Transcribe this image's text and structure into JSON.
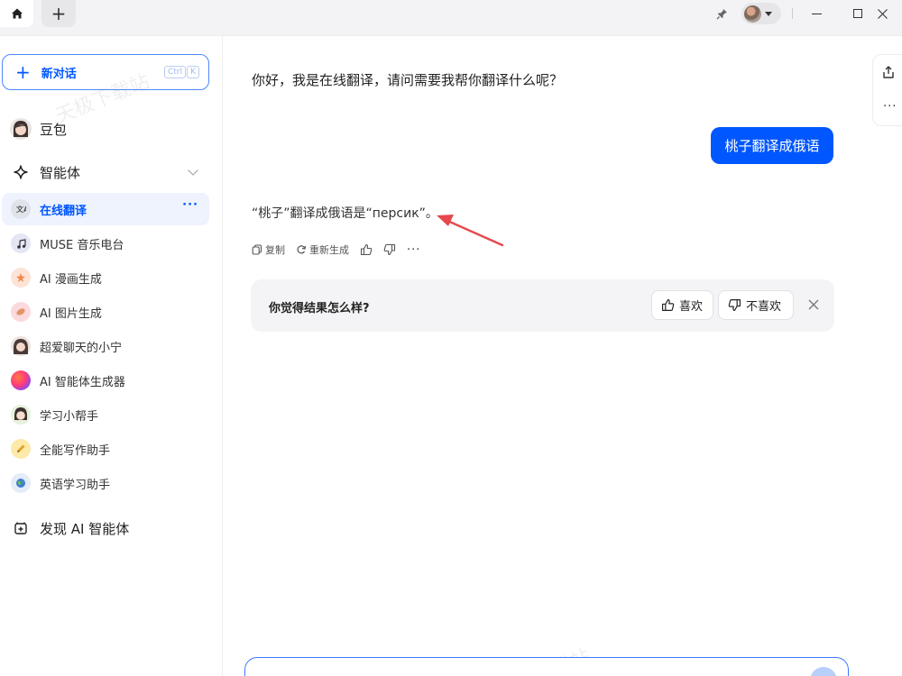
{
  "titlebar": {
    "tab_plus": "+"
  },
  "sidebar": {
    "new_chat_label": "新对话",
    "shortcut": [
      "Ctrl",
      "K"
    ],
    "doubao_label": "豆包",
    "agents_label": "智能体",
    "items": [
      {
        "label": "在线翻译",
        "icon": "translate-icon",
        "active": true,
        "more": "···"
      },
      {
        "label": "MUSE 音乐电台",
        "icon": "music-note-icon"
      },
      {
        "label": "AI 漫画生成",
        "icon": "comic-icon"
      },
      {
        "label": "AI 图片生成",
        "icon": "image-icon"
      },
      {
        "label": "超爱聊天的小宁",
        "icon": "avatar-icon"
      },
      {
        "label": "AI 智能体生成器",
        "icon": "agent-generator-icon"
      },
      {
        "label": "学习小帮手",
        "icon": "avatar-icon"
      },
      {
        "label": "全能写作助手",
        "icon": "pen-icon"
      },
      {
        "label": "英语学习助手",
        "icon": "globe-icon"
      }
    ],
    "discover_label": "发现 AI 智能体"
  },
  "chat": {
    "greeting": "你好，我是在线翻译，请问需要我帮你翻译什么呢？",
    "user_message": "桃子翻译成俄语",
    "answer": "“桃子”翻译成俄语是“персик”。",
    "actions": {
      "copy": "复制",
      "regenerate": "重新生成",
      "more": "···"
    },
    "feedback": {
      "question": "你觉得结果怎么样?",
      "like": "喜欢",
      "dislike": "不喜欢"
    }
  },
  "side_tools": {
    "more": "···"
  },
  "watermark": "天极下载站",
  "colors": {
    "accent": "#0057ff",
    "active_bg": "#eef3fe",
    "feedback_bg": "#f4f4f6",
    "annotation_arrow": "#e5484d"
  }
}
